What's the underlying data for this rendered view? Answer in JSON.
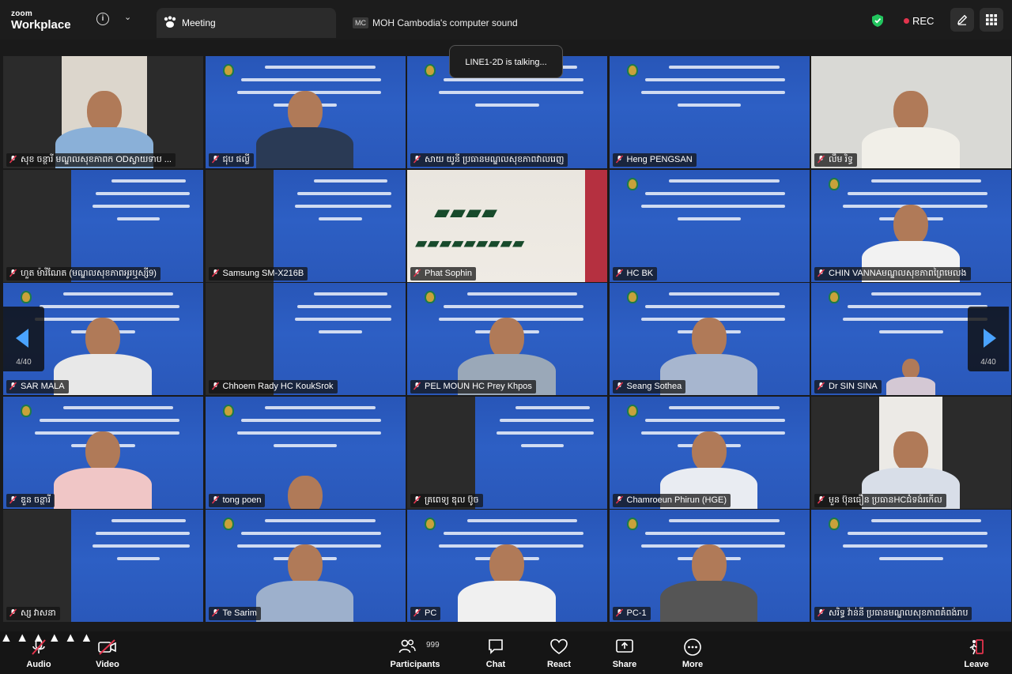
{
  "topbar": {
    "brand_small": "zoom",
    "brand_large": "Workplace",
    "info_icon": "info-icon",
    "meeting_tab_label": "Meeting",
    "sound_tab_badge": "MC",
    "sound_tab_label": "MOH Cambodia's computer sound",
    "rec_label": "REC",
    "colors": {
      "rec_dot": "#e3344d",
      "shield": "#22c55e",
      "accent": "#4aa3ff"
    }
  },
  "talking_indicator": "LINE1-2D is talking...",
  "pager": {
    "left_page": "4/40",
    "right_page": "4/40"
  },
  "participants": [
    "សុខ ចន្ថារី មណ្ឌលសុខភាពក ODស្វាយទាប ...",
    "ជុប ផល្លី",
    "សាយ យូនី ប្រធានមណ្ឌលសុខភាពវាលរេញ",
    "Heng PENGSAN",
    "លឹម រិទ្ធ",
    "ហួត ម៉ារីណែត (មណ្ឌលសុខភាពអូរឬស្សី9)",
    "Samsung SM-X216B",
    "Phat Sophin",
    "HC BK",
    "CHIN VANNAមណ្ឌលសុខភាពព្រៃមេលង",
    "SAR MALA",
    "Chhoem Rady HC KoukSrok",
    "PEL MOUN  HC Prey Khpos",
    "Seang Sothea",
    "Dr SIN SINA",
    "ឌួន ចន្ថារី",
    "tong poen",
    "គ្រពេទ្យ ឌុល ប៊ូច",
    "Chamroeun Phirun (HGE)",
    "មួន ប៊ុនធឿន ប្រធានHCជំទង់រកើល",
    "ស្ស វាសនា",
    "Te Sarim",
    "PC",
    "PC-1",
    "សរិទ្ធ វ៉ាន់នី ប្រធានមណ្ឌលសុខភាពគំពង់រាប"
  ],
  "toolbar": {
    "audio": "Audio",
    "video": "Video",
    "participants": "Participants",
    "participants_count": "999",
    "chat": "Chat",
    "react": "React",
    "share": "Share",
    "more": "More",
    "leave": "Leave"
  }
}
